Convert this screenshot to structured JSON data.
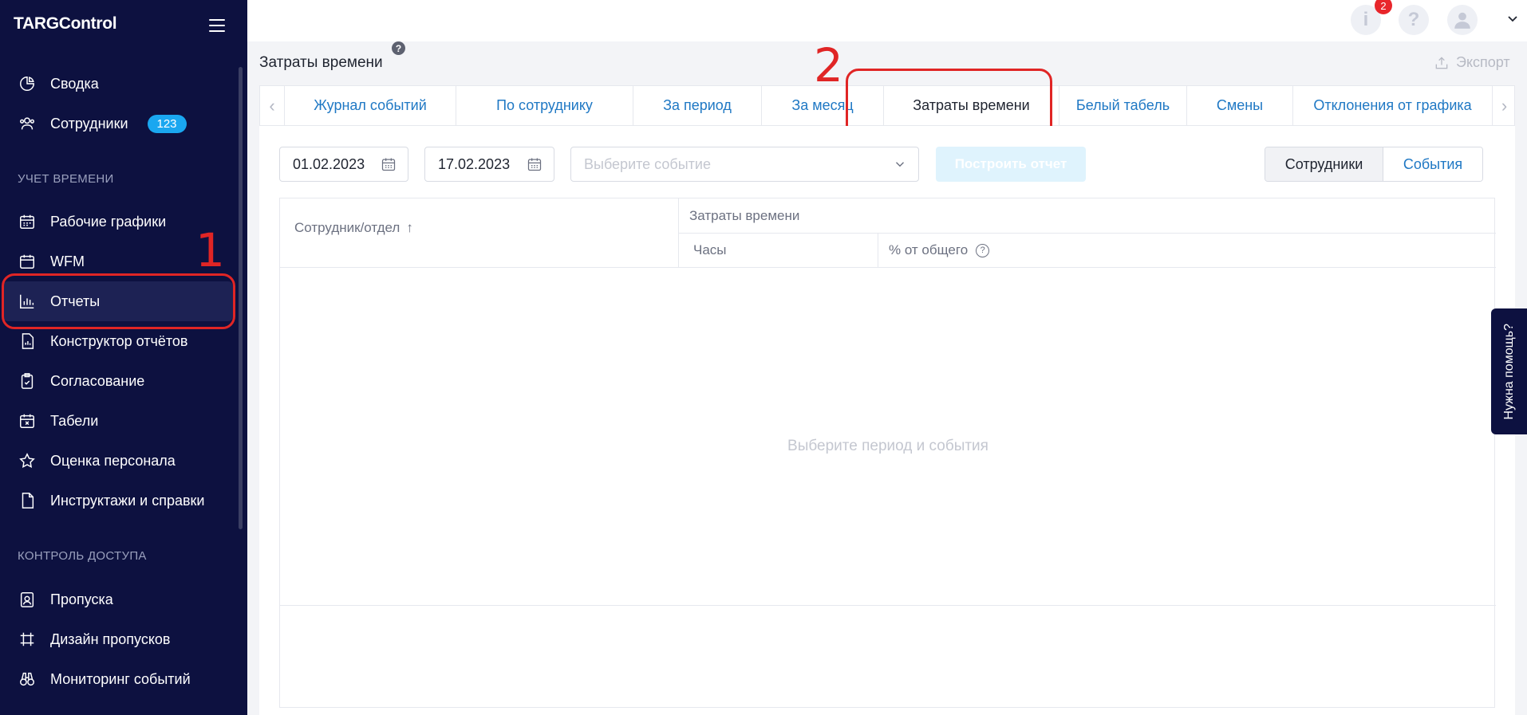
{
  "sidebar": {
    "brand": "TARGControl",
    "items": [
      {
        "label": "Сводка"
      },
      {
        "label": "Сотрудники",
        "badge": "123"
      },
      {
        "label": "Рабочие графики"
      },
      {
        "label": "WFM"
      },
      {
        "label": "Отчеты"
      },
      {
        "label": "Конструктор отчётов"
      },
      {
        "label": "Согласование"
      },
      {
        "label": "Табели"
      },
      {
        "label": "Оценка персонала"
      },
      {
        "label": "Инструктажи и справки"
      },
      {
        "label": "Пропуска"
      },
      {
        "label": "Дизайн пропусков"
      },
      {
        "label": "Мониторинг событий"
      }
    ],
    "sections": [
      "УЧЕТ ВРЕМЕНИ",
      "КОНТРОЛЬ ДОСТУПА"
    ]
  },
  "topbar": {
    "notification_count": "2"
  },
  "page": {
    "title": "Затраты времени",
    "export_label": "Экспорт"
  },
  "tabs": [
    {
      "label": "Журнал событий"
    },
    {
      "label": "По сотруднику"
    },
    {
      "label": "За период"
    },
    {
      "label": "За месяц"
    },
    {
      "label": "Затраты времени",
      "active": true
    },
    {
      "label": "Белый табель"
    },
    {
      "label": "Смены"
    },
    {
      "label": "Отклонения от графика"
    }
  ],
  "filters": {
    "date_from": "01.02.2023",
    "date_to": "17.02.2023",
    "event_placeholder": "Выберите событие",
    "build_label": "Построить отчет",
    "view_employees": "Сотрудники",
    "view_events": "События"
  },
  "table": {
    "col_employee": "Сотрудник/отдел",
    "sort_arrow": "↑",
    "group_header": "Затраты времени",
    "col_hours": "Часы",
    "col_percent": "% от общего",
    "empty_text": "Выберите период и события"
  },
  "help_widget": "Нужна помощь?",
  "annotations": {
    "one": "1",
    "two": "2"
  },
  "colors": {
    "sidebar_bg": "#0d1140",
    "accent": "#1f78c4",
    "badge": "#1aa7f0",
    "annotation": "#e02525"
  }
}
